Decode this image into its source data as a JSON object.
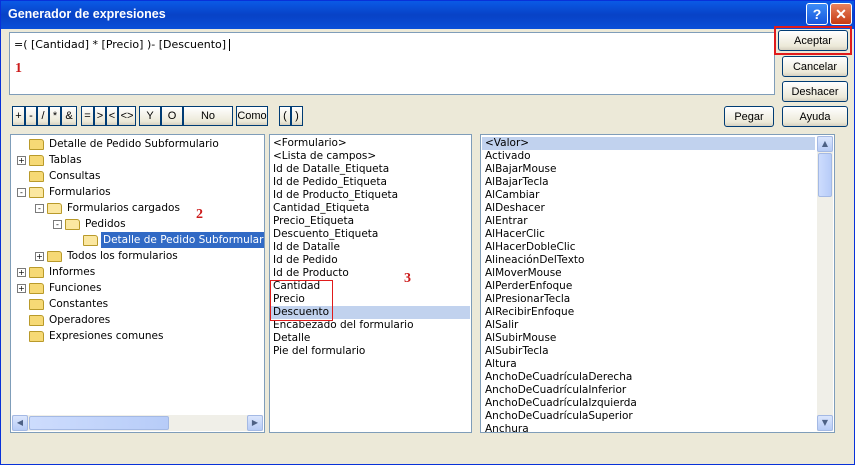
{
  "window": {
    "title": "Generador de expresiones"
  },
  "expression": {
    "text": "=( [Cantidad] * [Precio] )- [Descuento]"
  },
  "callouts": {
    "one": "1",
    "two": "2",
    "three": "3"
  },
  "buttons": {
    "accept": "Aceptar",
    "cancel": "Cancelar",
    "undo": "Deshacer",
    "help": "Ayuda",
    "paste": "Pegar"
  },
  "operators": {
    "plus": "+",
    "minus": "-",
    "divide": "/",
    "multiply": "*",
    "amp": "&",
    "equals": "=",
    "greater": ">",
    "less": "<",
    "notequal": "<>",
    "and": "Y",
    "or": "O",
    "not": "No",
    "like": "Como",
    "lparen": "(",
    "rparen": ")"
  },
  "tree": [
    {
      "label": "Detalle de Pedido Subformulario",
      "indent": 0,
      "toggle": "",
      "open": false,
      "selected": false
    },
    {
      "label": "Tablas",
      "indent": 0,
      "toggle": "+",
      "open": false,
      "selected": false
    },
    {
      "label": "Consultas",
      "indent": 0,
      "toggle": "",
      "open": false,
      "selected": false
    },
    {
      "label": "Formularios",
      "indent": 0,
      "toggle": "-",
      "open": true,
      "selected": false
    },
    {
      "label": "Formularios cargados",
      "indent": 1,
      "toggle": "-",
      "open": true,
      "selected": false
    },
    {
      "label": "Pedidos",
      "indent": 2,
      "toggle": "-",
      "open": true,
      "selected": false
    },
    {
      "label": "Detalle de Pedido Subformulario",
      "indent": 3,
      "toggle": "",
      "open": true,
      "selected": true
    },
    {
      "label": "Todos los formularios",
      "indent": 1,
      "toggle": "+",
      "open": false,
      "selected": false
    },
    {
      "label": "Informes",
      "indent": 0,
      "toggle": "+",
      "open": false,
      "selected": false
    },
    {
      "label": "Funciones",
      "indent": 0,
      "toggle": "+",
      "open": false,
      "selected": false
    },
    {
      "label": "Constantes",
      "indent": 0,
      "toggle": "",
      "open": false,
      "selected": false
    },
    {
      "label": "Operadores",
      "indent": 0,
      "toggle": "",
      "open": false,
      "selected": false
    },
    {
      "label": "Expresiones comunes",
      "indent": 0,
      "toggle": "",
      "open": false,
      "selected": false
    }
  ],
  "fields": [
    "<Formulario>",
    "<Lista de campos>",
    "Id de Datalle_Etiqueta",
    "Id de Pedido_Etiqueta",
    "Id de Producto_Etiqueta",
    "Cantidad_Etiqueta",
    "Precio_Etiqueta",
    "Descuento_Etiqueta",
    "Id de Datalle",
    "Id de Pedido",
    "Id de Producto",
    "Cantidad",
    "Precio",
    "Descuento",
    "Encabezado del formulario",
    "Detalle",
    "Pie del formulario"
  ],
  "fields_selected": "Descuento",
  "values": [
    "<Valor>",
    "Activado",
    "AlBajarMouse",
    "AlBajarTecla",
    "AlCambiar",
    "AlDeshacer",
    "AlEntrar",
    "AlHacerClic",
    "AlHacerDobleClic",
    "AlineaciónDelTexto",
    "AlMoverMouse",
    "AlPerderEnfoque",
    "AlPresionarTecla",
    "AlRecibirEnfoque",
    "AlSalir",
    "AlSubirMouse",
    "AlSubirTecla",
    "Altura",
    "AnchoDeCuadrículaDerecha",
    "AnchoDeCuadrículaInferior",
    "AnchoDeCuadrículaIzquierda",
    "AnchoDeCuadrículaSuperior",
    "Anchura"
  ],
  "values_selected": "<Valor>",
  "icons": {
    "help": "?",
    "close": "✕",
    "up": "▲",
    "down": "▼",
    "left": "◀",
    "right": "▶"
  }
}
